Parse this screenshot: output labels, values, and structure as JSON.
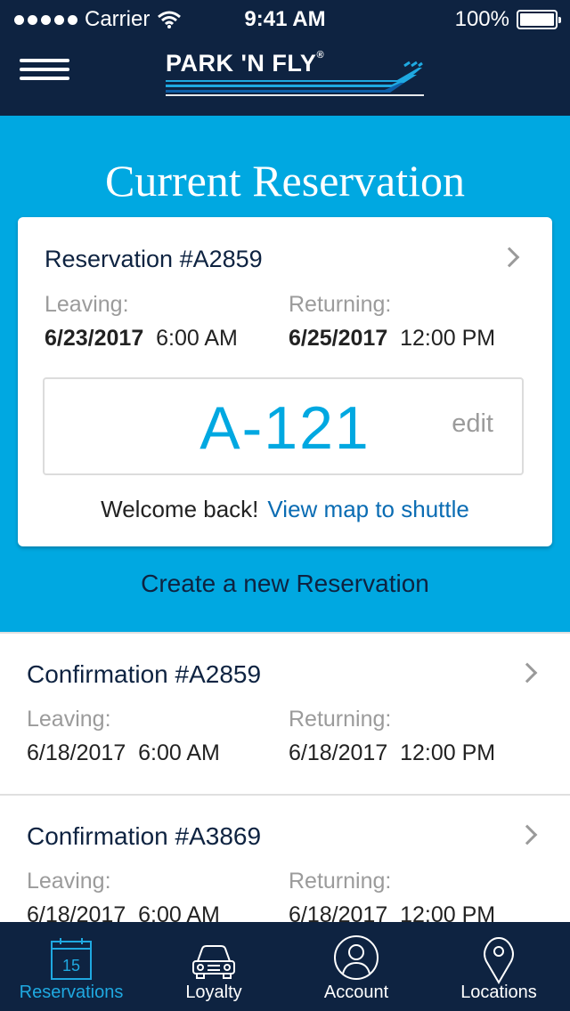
{
  "status_bar": {
    "carrier": "Carrier",
    "time": "9:41 AM",
    "battery": "100%"
  },
  "header": {
    "logo_text": "PARK 'N FLY",
    "logo_reg": "®",
    "menu_icon": "hamburger-menu-icon"
  },
  "hero": {
    "title": "Current Reservation",
    "background": "#00a8e1"
  },
  "current_reservation": {
    "title": "Reservation #A2859",
    "leaving_label": "Leaving:",
    "leaving_date": "6/23/2017",
    "leaving_time": "6:00 AM",
    "returning_label": "Returning:",
    "returning_date": "6/25/2017",
    "returning_time": "12:00 PM",
    "spot": "A-121",
    "edit": "edit",
    "welcome": "Welcome back!",
    "map_link": "View map to shuttle"
  },
  "create_link": "Create a new Reservation",
  "confirmations": [
    {
      "title": "Confirmation #A2859",
      "leaving_label": "Leaving:",
      "leaving": "6/18/2017  6:00 AM",
      "returning_label": "Returning:",
      "returning": "6/18/2017  12:00 PM"
    },
    {
      "title": "Confirmation #A3869",
      "leaving_label": "Leaving:",
      "leaving": "6/18/2017  6:00 AM",
      "returning_label": "Returning:",
      "returning": "6/18/2017  12:00 PM"
    }
  ],
  "tabbar": {
    "calendar_day": "15",
    "tabs": [
      {
        "label": "Reservations",
        "icon": "calendar-icon",
        "active": true
      },
      {
        "label": "Loyalty",
        "icon": "car-icon",
        "active": false
      },
      {
        "label": "Account",
        "icon": "user-icon",
        "active": false
      },
      {
        "label": "Locations",
        "icon": "location-pin-icon",
        "active": false
      }
    ]
  },
  "colors": {
    "navy": "#0e2341",
    "accent": "#00a8e1",
    "link": "#0a6cb3",
    "active_tab": "#1fa9e1"
  }
}
